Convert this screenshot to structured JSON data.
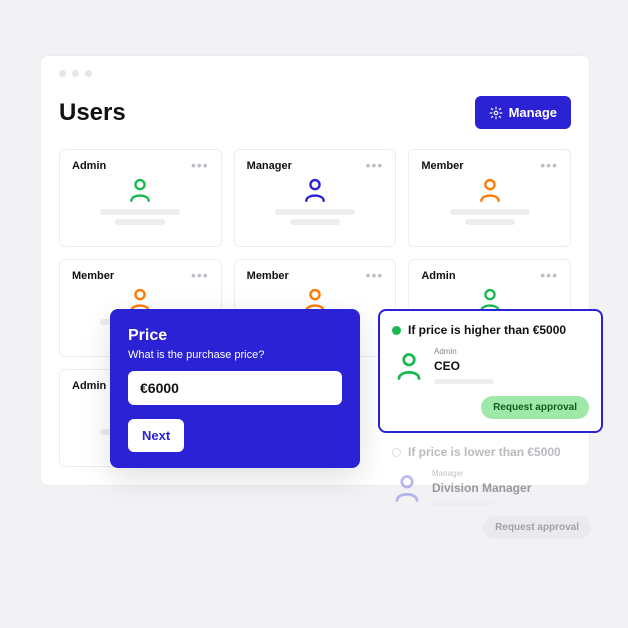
{
  "page": {
    "title": "Users",
    "manage_label": "Manage"
  },
  "cards": [
    {
      "role": "Admin",
      "color": "#18b851"
    },
    {
      "role": "Manager",
      "color": "#2b22d6"
    },
    {
      "role": "Member",
      "color": "#ff7a00"
    },
    {
      "role": "Member",
      "color": "#ff7a00"
    },
    {
      "role": "Member",
      "color": "#ff7a00"
    },
    {
      "role": "Admin",
      "color": "#18b851"
    },
    {
      "role": "Admin",
      "color": "#18b851"
    }
  ],
  "price_modal": {
    "title": "Price",
    "subtitle": "What is the purchase price?",
    "value": "€6000",
    "next_label": "Next"
  },
  "approval": {
    "rule1": {
      "title": "If price is higher than €5000",
      "role": "Admin",
      "name": "CEO",
      "button": "Request approval",
      "icon_color": "#18b851"
    },
    "rule2": {
      "title": "If price is lower than €5000",
      "role": "Manager",
      "name": "Division Manager",
      "button": "Request approval",
      "icon_color": "#8b8be6"
    }
  }
}
